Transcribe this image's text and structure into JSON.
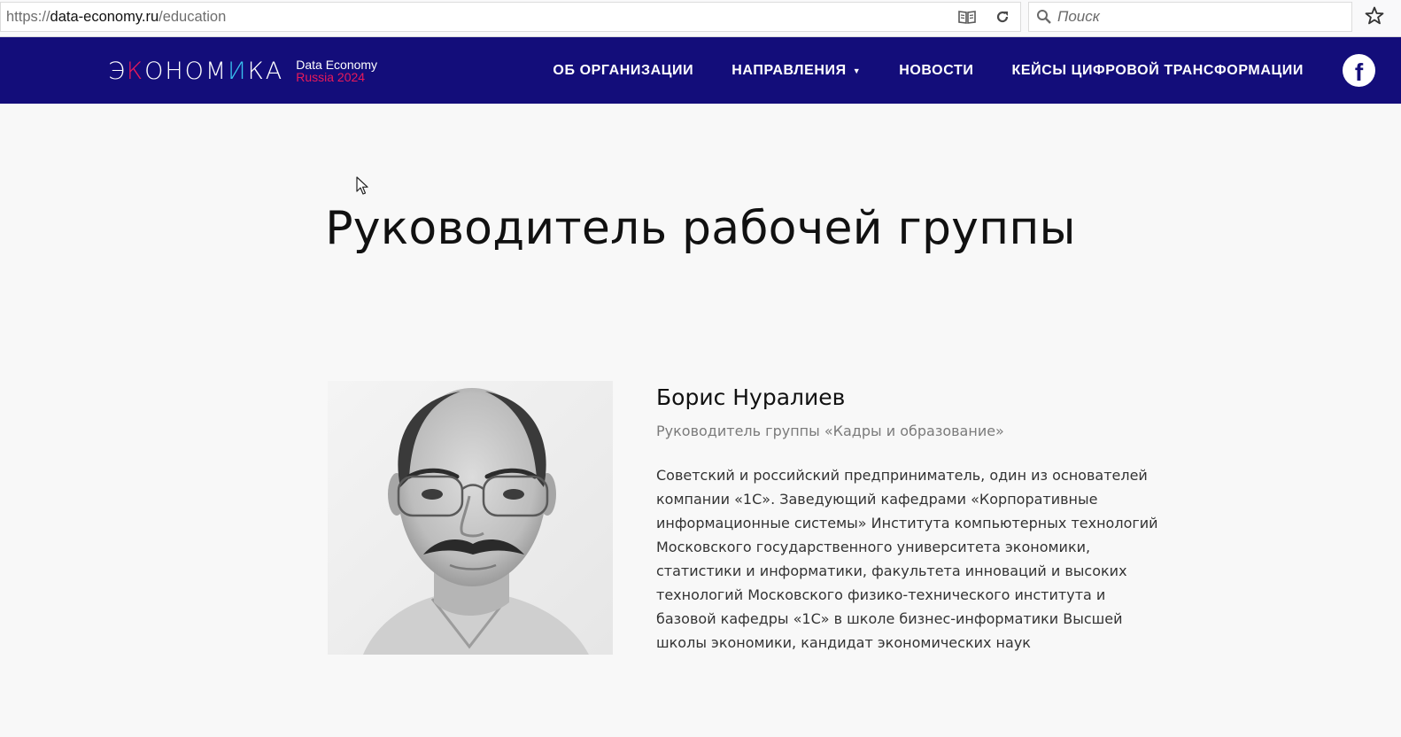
{
  "browser": {
    "url_scheme": "https://",
    "url_host": "data-economy.ru",
    "url_path": "/education",
    "search_placeholder": "Поиск",
    "icons": [
      "reader-mode-icon",
      "reload-icon",
      "search-icon",
      "bookmark-star-icon"
    ]
  },
  "header": {
    "logo": {
      "word_start": "Э",
      "word_k": "К",
      "word_mid": "ОНОМ",
      "word_i": "И",
      "word_end": "КА",
      "line1": "Data Economy",
      "line2": "Russia 2024"
    },
    "nav": {
      "about": "ОБ ОРГАНИЗАЦИИ",
      "directions": "НАПРАВЛЕНИЯ",
      "news": "НОВОСТИ",
      "cases": "КЕЙСЫ ЦИФРОВОЙ ТРАНСФОРМАЦИИ"
    },
    "social": "f"
  },
  "main": {
    "title": "Руководитель рабочей группы",
    "person": {
      "name": "Борис Нуралиев",
      "role": "Руководитель группы «Кадры и образование»",
      "bio": "Советский и российский предприниматель, один из основателей компании «1С». Заведующий кафедрами «Корпоративные информационные системы» Института компьютерных технологий Московского государственного университета экономики, статистики и информатики, факультета инноваций и высоких технологий Московского физико-технического института и базовой кафедры «1С» в школе бизнес-информатики Высшей школы экономики, кандидат экономических наук"
    }
  },
  "colors": {
    "header_bg": "#130d7a",
    "logo_accent": "#e8195a",
    "logo_blue": "#39c2f0",
    "page_bg": "#f8f8f8"
  }
}
